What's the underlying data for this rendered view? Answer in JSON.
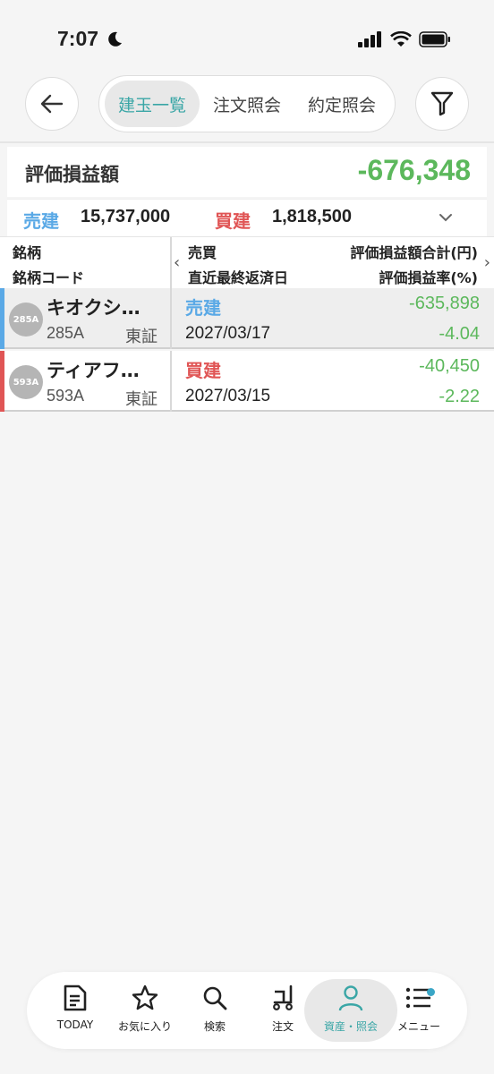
{
  "status": {
    "time": "7:07"
  },
  "nav": {
    "tabs": [
      {
        "label": "建玉一覧",
        "active": true
      },
      {
        "label": "注文照会",
        "active": false
      },
      {
        "label": "約定照会",
        "active": false
      }
    ]
  },
  "summary": {
    "label": "評価損益額",
    "value": "-676,348",
    "sell_label": "売建",
    "sell_value": "15,737,000",
    "buy_label": "買建",
    "buy_value": "1,818,500"
  },
  "table": {
    "headers": {
      "c1r1": "銘柄",
      "c1r2": "銘柄コード",
      "c2r1": "売買",
      "c2r2": "直近最終返済日",
      "c3r1": "評価損益額合計(円)",
      "c3r2": "評価損益率(%)"
    },
    "rows": [
      {
        "badge": "285A",
        "name": "キオクシ…",
        "code": "285A",
        "market": "東証",
        "side": "売建",
        "date": "2027/03/17",
        "pl": "-635,898",
        "rate": "-4.04"
      },
      {
        "badge": "593A",
        "name": "ティアフ…",
        "code": "593A",
        "market": "東証",
        "side": "買建",
        "date": "2027/03/15",
        "pl": "-40,450",
        "rate": "-2.22"
      }
    ]
  },
  "tabbar": {
    "items": [
      {
        "label": "TODAY",
        "icon": "document-icon"
      },
      {
        "label": "お気に入り",
        "icon": "star-icon"
      },
      {
        "label": "検索",
        "icon": "search-icon"
      },
      {
        "label": "注文",
        "icon": "cart-icon"
      },
      {
        "label": "資産・照会",
        "icon": "person-icon",
        "active": true
      },
      {
        "label": "メニュー",
        "icon": "list-icon"
      }
    ]
  },
  "colors": {
    "accent": "#3aa6a6",
    "sell": "#5aa9e6",
    "buy": "#e05555",
    "loss": "#5cb85c"
  }
}
